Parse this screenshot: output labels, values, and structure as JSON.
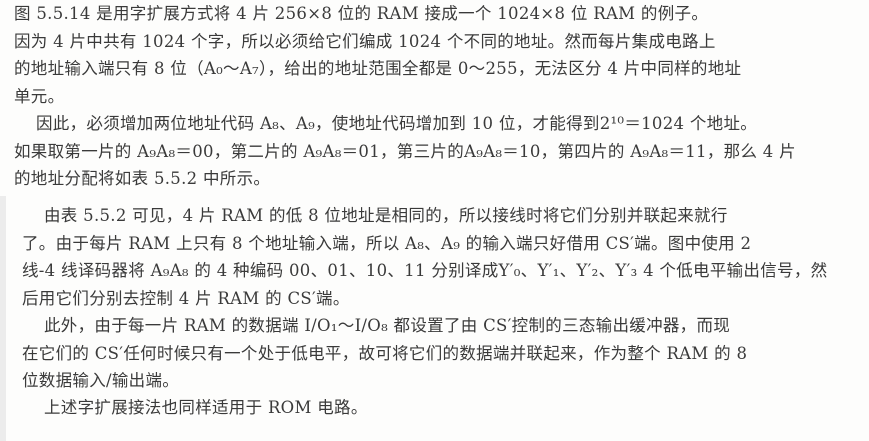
{
  "paragraphs": [
    {
      "id": "p1",
      "lines": [
        "图 5.5.14 是用字扩展方式将 4 片 256×8 位的 RAM 接成一个 1024×8 位 RAM 的例子。",
        "因为 4 片中共有 1024 个字，所以必须给它们编成 1024 个不同的地址。然而每片集成电路上",
        "的地址输入端只有 8 位（A₀～A₇），给出的地址范围全都是 0～255，无法区分 4 片中同样的地址",
        "单元。"
      ]
    },
    {
      "id": "p2",
      "lines": [
        "因此，必须增加两位地址代码 A₈、A₉，使地址代码增加到 10 位，才能得到2¹⁰＝1024 个地址。",
        "如果取第一片的 A₉A₈＝00，第二片的 A₉A₈＝01，第三片的A₉A₈＝10，第四片的 A₉A₈＝11，那么 4 片",
        "的地址分配将如表 5.5.2 中所示。"
      ]
    },
    {
      "id": "p3",
      "lines": [
        "由表 5.5.2 可见，4 片 RAM 的低 8 位地址是相同的，所以接线时将它们分别并联起来就行",
        "了。由于每片 RAM 上只有 8 个地址输入端，所以 A₈、A₉ 的输入端只好借用 CS′端。图中使用 2",
        "线-4 线译码器将 A₉A₈ 的 4 种编码 00、01、10、11 分别译成Y′₀、Y′₁、Y′₂、Y′₃ 4 个低电平输出信号，然",
        "后用它们分别去控制 4 片 RAM 的 CS′端。"
      ]
    },
    {
      "id": "p4",
      "lines": [
        "此外，由于每一片 RAM 的数据端 I/O₁～I/O₈ 都设置了由 CS′控制的三态输出缓冲器，而现",
        "在它们的 CS′任何时候只有一个处于低电平，故可将它们的数据端并联起来，作为整个 RAM 的 8",
        "位数据输入/输出端。"
      ]
    },
    {
      "id": "p5",
      "lines": [
        "上述字扩展接法也同样适用于 ROM 电路。"
      ]
    }
  ]
}
